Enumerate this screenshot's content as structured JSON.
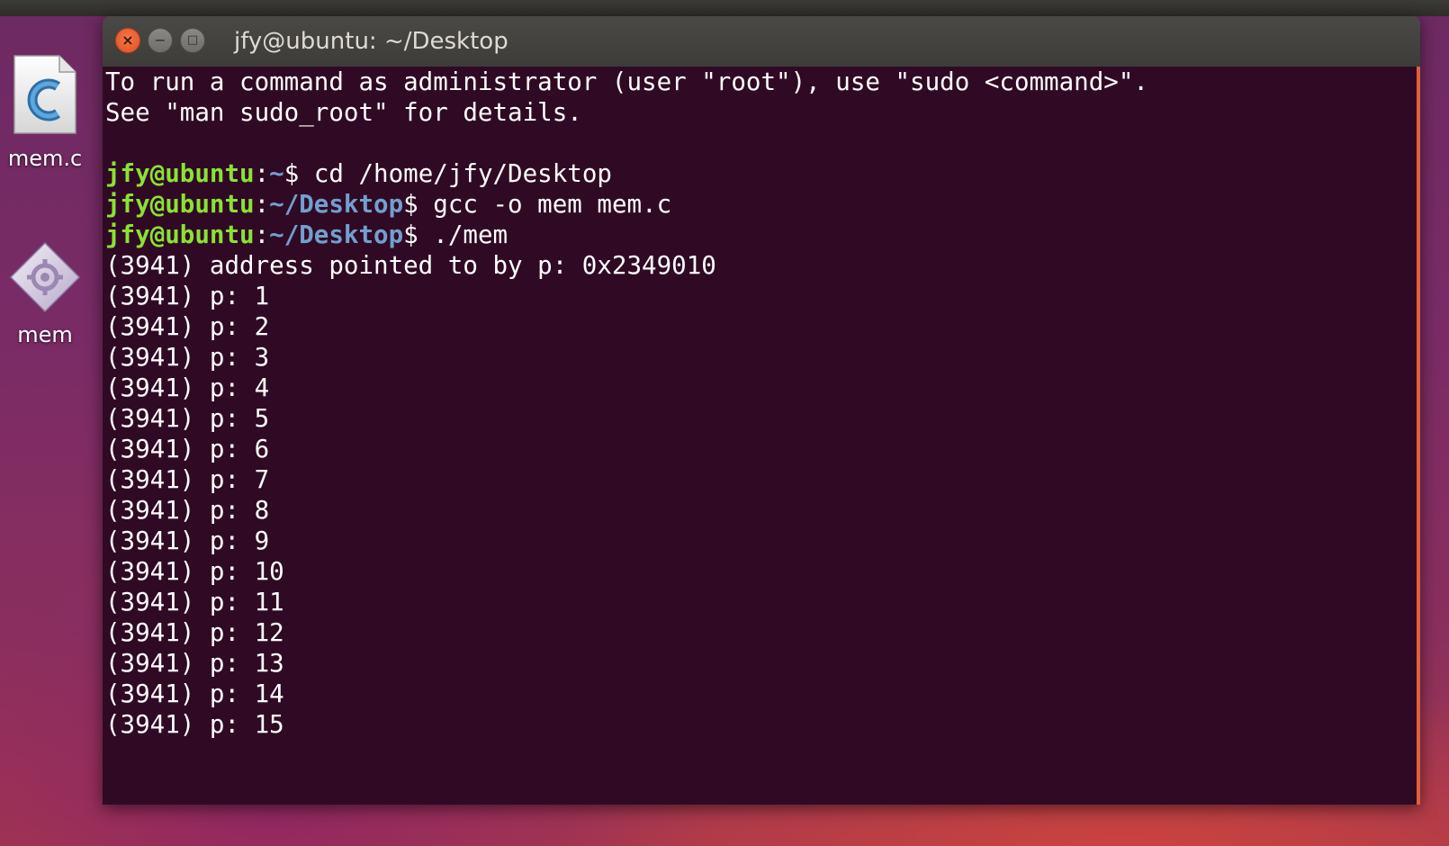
{
  "desktop": {
    "icons": [
      {
        "label": "mem.c",
        "icon": "c-source-file-icon"
      },
      {
        "label": "mem",
        "icon": "executable-icon"
      }
    ]
  },
  "window": {
    "title": "jfy@ubuntu: ~/Desktop",
    "buttons": {
      "close": "×",
      "minimize": "−",
      "maximize": "□"
    }
  },
  "terminal": {
    "colors": {
      "background": "#300a24",
      "user": "#8ae234",
      "path": "#729fcf",
      "text": "#ffffff"
    },
    "intro": [
      "To run a command as administrator (user \"root\"), use \"sudo <command>\".",
      "See \"man sudo_root\" for details.",
      ""
    ],
    "commands": [
      {
        "user": "jfy@ubuntu",
        "sep": ":",
        "path": "~",
        "symbol": "$",
        "command": " cd /home/jfy/Desktop"
      },
      {
        "user": "jfy@ubuntu",
        "sep": ":",
        "path": "~/Desktop",
        "symbol": "$",
        "command": " gcc -o mem mem.c"
      },
      {
        "user": "jfy@ubuntu",
        "sep": ":",
        "path": "~/Desktop",
        "symbol": "$",
        "command": " ./mem"
      }
    ],
    "output": [
      "(3941) address pointed to by p: 0x2349010",
      "(3941) p: 1",
      "(3941) p: 2",
      "(3941) p: 3",
      "(3941) p: 4",
      "(3941) p: 5",
      "(3941) p: 6",
      "(3941) p: 7",
      "(3941) p: 8",
      "(3941) p: 9",
      "(3941) p: 10",
      "(3941) p: 11",
      "(3941) p: 12",
      "(3941) p: 13",
      "(3941) p: 14",
      "(3941) p: 15"
    ]
  }
}
